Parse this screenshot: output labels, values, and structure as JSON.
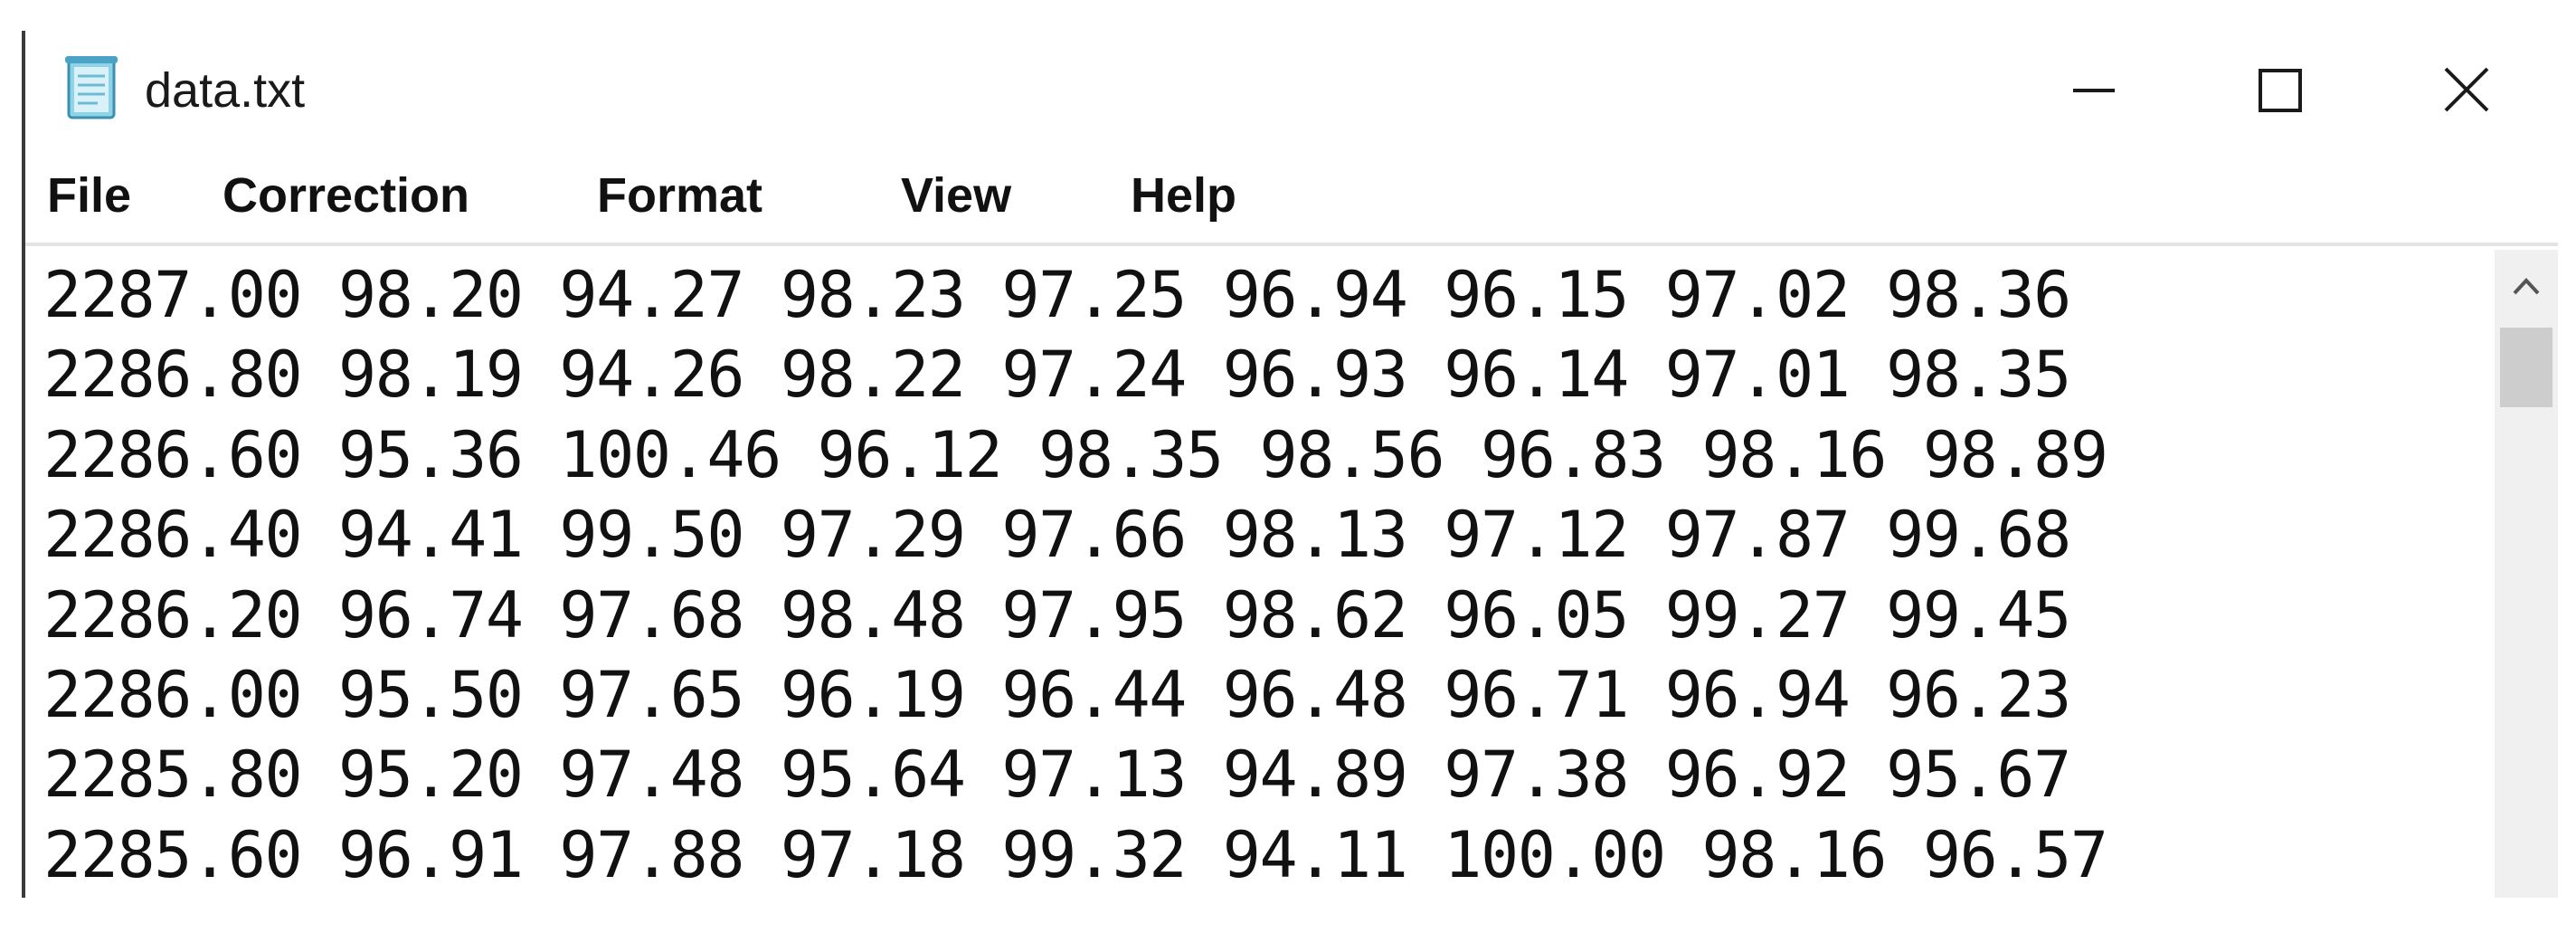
{
  "window": {
    "title": "data.txt",
    "icon": "notepad-icon",
    "controls": {
      "minimize": "minimize-icon",
      "maximize": "maximize-icon",
      "close": "close-icon"
    }
  },
  "menu": {
    "items": [
      {
        "label": "File"
      },
      {
        "label": "Correction"
      },
      {
        "label": "Format"
      },
      {
        "label": "View"
      },
      {
        "label": "Help"
      }
    ]
  },
  "editor": {
    "lines": [
      "2287.00 98.20 94.27 98.23 97.25 96.94 96.15 97.02 98.36",
      "2286.80 98.19 94.26 98.22 97.24 96.93 96.14 97.01 98.35",
      "2286.60 95.36 100.46 96.12 98.35 98.56 96.83 98.16 98.89",
      "2286.40 94.41 99.50 97.29 97.66 98.13 97.12 97.87 99.68",
      "2286.20 96.74 97.68 98.48 97.95 98.62 96.05 99.27 99.45",
      "2286.00 95.50 97.65 96.19 96.44 96.48 96.71 96.94 96.23",
      "2285.80 95.20 97.48 95.64 97.13 94.89 97.38 96.92 95.67",
      "2285.60 96.91 97.88 97.18 99.32 94.11 100.00 98.16 96.57"
    ]
  },
  "scrollbar": {
    "up_icon": "chevron-up-icon",
    "position": 0
  },
  "colors": {
    "background": "#ffffff",
    "text": "#111111",
    "scrollbar_track": "#f0f0f0",
    "scrollbar_thumb": "#cdcdcd",
    "divider": "#e4e4e4"
  }
}
